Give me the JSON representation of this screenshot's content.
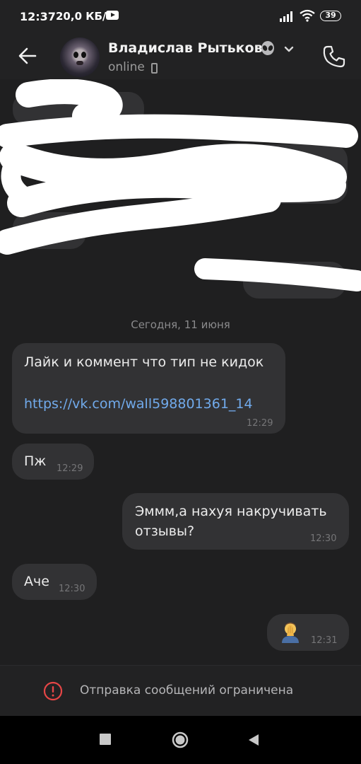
{
  "status_bar": {
    "time": "12:37",
    "speed": "20,0 КБ/с",
    "battery": "39"
  },
  "header": {
    "name": "Владислав Рытьков",
    "status": "online"
  },
  "date_separator": "Сегодня, 11 июня",
  "messages": [
    {
      "side": "in",
      "text_line1": "Лайк и коммент что тип не кидок",
      "link": "https://vk.com/wall598801361_14",
      "time": "12:29"
    },
    {
      "side": "in",
      "text": "Пж",
      "time": "12:29"
    },
    {
      "side": "out",
      "text_line1": "Эммм,а нахуя накручивать",
      "text_line2": "отзывы?",
      "time": "12:30"
    },
    {
      "side": "in",
      "text": "Аче",
      "time": "12:30"
    },
    {
      "side": "out",
      "emoji": "🤦‍♂️",
      "time": "12:31"
    }
  ],
  "footer": {
    "notice": "Отправка сообщений ограничена"
  },
  "colors": {
    "background": "#1f1f20",
    "bubble": "#323234",
    "link": "#71aaeb",
    "warning": "#e64646"
  }
}
